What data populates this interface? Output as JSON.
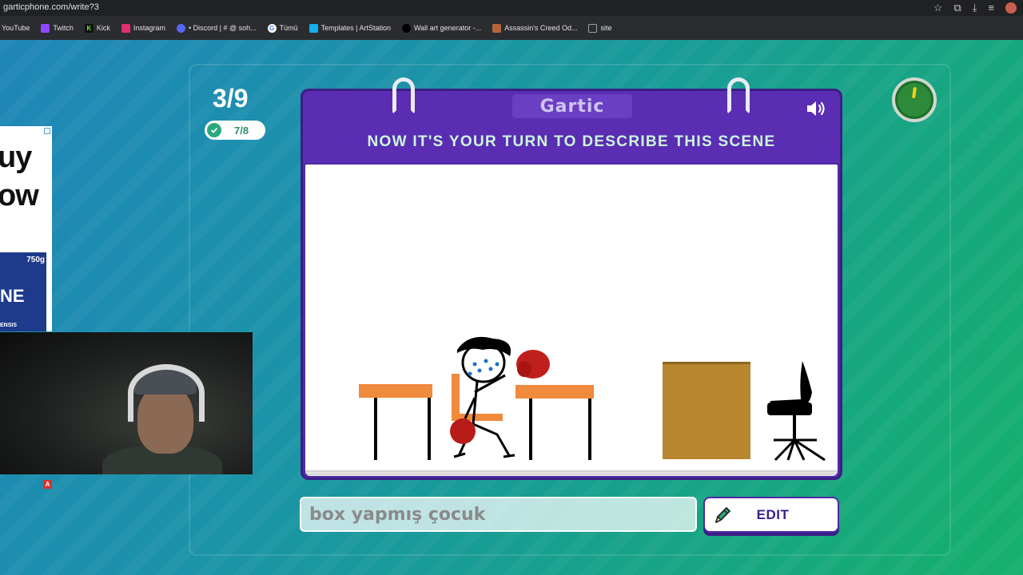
{
  "browser": {
    "url": "garticphone.com/write?3",
    "bookmarks": [
      {
        "label": "YouTube",
        "color": "#ff0000"
      },
      {
        "label": "Twitch",
        "color": "#9146ff"
      },
      {
        "label": "Kick",
        "color": "#53fc18"
      },
      {
        "label": "Instagram",
        "color": "#e1306c"
      },
      {
        "label": "• Discord | # @ soh...",
        "color": "#5865f2"
      },
      {
        "label": "Tümü",
        "color": "#4285f4"
      },
      {
        "label": "Templates | ArtStation",
        "color": "#13aff0"
      },
      {
        "label": "Wall art generator -...",
        "color": "#000000"
      },
      {
        "label": "Assassin's Creed Od...",
        "color": "#b5653b"
      },
      {
        "label": "site",
        "color": "#9aa0a6"
      }
    ]
  },
  "ad": {
    "line1": "uy",
    "line2": "ow",
    "weight": "750g",
    "brand": "NE",
    "sub": "ENSIS",
    "badge": "A"
  },
  "game": {
    "round": "3/9",
    "done_count": "7/8",
    "logo": "Gartic",
    "instruction": "NOW IT'S YOUR TURN TO DESCRIBE THIS SCENE",
    "answer_value": "box yapmış çocuk",
    "edit_label": "EDIT"
  },
  "colors": {
    "card_purple": "#5a2db3",
    "instruction_green": "#ccf7de",
    "accent_green": "#2aa87b"
  },
  "icons": {
    "sound": "speaker-icon",
    "edit": "pencil-icon",
    "timer": "timer-icon",
    "done": "check-icon"
  }
}
